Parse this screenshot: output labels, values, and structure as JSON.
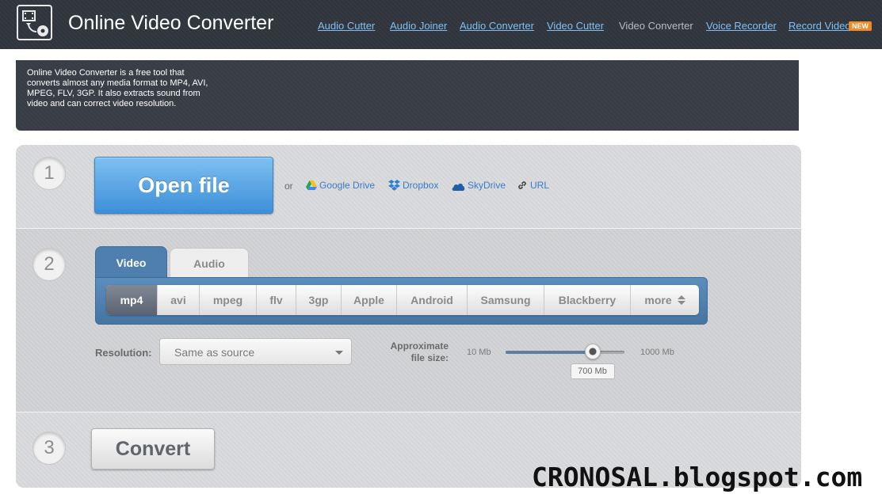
{
  "header": {
    "title": "Online Video Converter",
    "nav": [
      {
        "label": "Audio Cutter",
        "current": false
      },
      {
        "label": "Audio Joiner",
        "current": false
      },
      {
        "label": "Audio Converter",
        "current": false
      },
      {
        "label": "Video Cutter",
        "current": false
      },
      {
        "label": "Video Converter",
        "current": true
      },
      {
        "label": "Voice Recorder",
        "current": false
      },
      {
        "label": "Record Video",
        "current": false
      }
    ],
    "new_badge": "NEW",
    "logo_icon": "video-convert-icon",
    "link_color": "#7ec0f4"
  },
  "intro": {
    "text": "Online Video Converter is a free tool that converts almost any media format to MP4, AVI, MPEG, FLV, 3GP. It also extracts sound from video and can correct video resolution."
  },
  "steps": {
    "one": "1",
    "two": "2",
    "three": "3"
  },
  "open": {
    "button": "Open file",
    "or": "or",
    "sources": [
      {
        "label": "Google Drive",
        "icon": "google-drive-icon"
      },
      {
        "label": "Dropbox",
        "icon": "dropbox-icon"
      },
      {
        "label": "SkyDrive",
        "icon": "skydrive-icon"
      },
      {
        "label": "URL",
        "icon": "link-icon"
      }
    ]
  },
  "tabs": {
    "video": "Video",
    "audio": "Audio",
    "active": "Video"
  },
  "formats": {
    "items": [
      "mp4",
      "avi",
      "mpeg",
      "flv",
      "3gp",
      "Apple",
      "Android",
      "Samsung",
      "Blackberry",
      "more"
    ],
    "selected": "mp4"
  },
  "settings": {
    "resolution_label": "Resolution:",
    "resolution_value": "Same as source",
    "size_label_line1": "Approximate",
    "size_label_line2": "file size:",
    "min_label": "10 Mb",
    "max_label": "1000 Mb",
    "value_label": "700 Mb",
    "slider_fraction": 0.73
  },
  "convert": {
    "button": "Convert"
  },
  "watermark": "CRONOSAL.blogspot.com",
  "colors": {
    "header_bg": "#30353d",
    "accent_blue": "#4e7fae",
    "open_button": "#4a98e0",
    "badge": "#f08a24"
  }
}
